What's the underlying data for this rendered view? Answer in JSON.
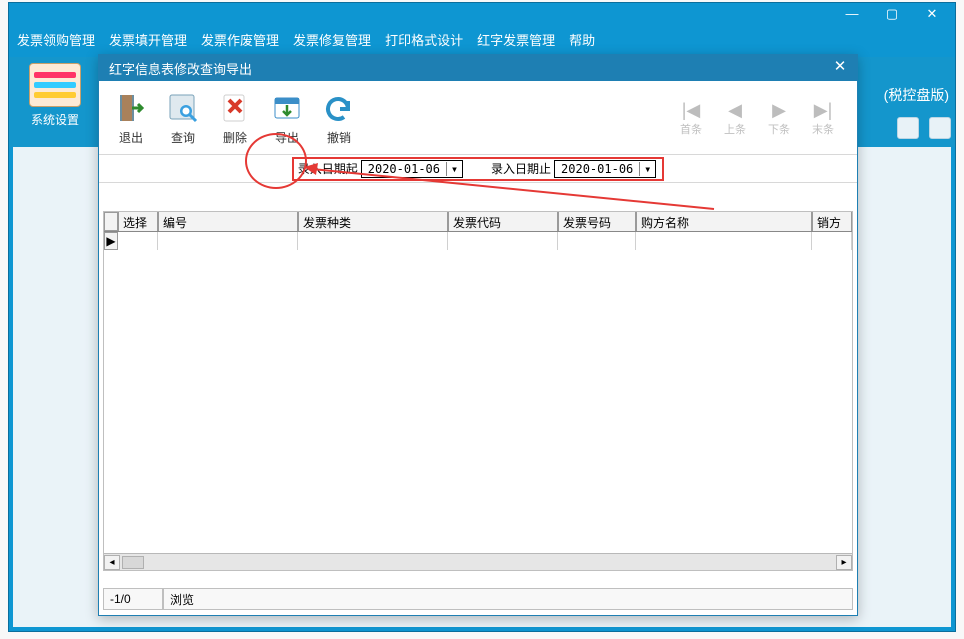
{
  "outer": {
    "menu": [
      "发票领购管理",
      "发票填开管理",
      "发票作废管理",
      "发票修复管理",
      "打印格式设计",
      "红字发票管理",
      "帮助"
    ],
    "sys_label": "系统设置",
    "right_tag": "(税控盘版)"
  },
  "dialog": {
    "title": "红字信息表修改查询导出",
    "toolbar": {
      "exit": "退出",
      "query": "查询",
      "delete": "删除",
      "export": "导出",
      "undo": "撤销"
    },
    "nav": {
      "first": "首条",
      "prev": "上条",
      "next": "下条",
      "last": "末条"
    },
    "filter": {
      "from_label": "录入日期起",
      "from_value": "2020-01-06",
      "to_label": "录入日期止",
      "to_value": "2020-01-06"
    },
    "columns": [
      "选择",
      "编号",
      "发票种类",
      "发票代码",
      "发票号码",
      "购方名称",
      "销方"
    ],
    "status": {
      "count": "-1/0",
      "mode": "浏览"
    }
  },
  "icons": {
    "exit": "door-arrow-icon",
    "query": "magnifier-icon",
    "delete": "x-red-icon",
    "export": "calendar-arrow-icon",
    "undo": "undo-arrow-icon",
    "first": "first-icon",
    "prev": "prev-icon",
    "next": "next-icon",
    "last": "last-icon",
    "close": "close-icon",
    "min": "minimize-icon",
    "max": "maximize-icon"
  },
  "colors": {
    "accent": "#1e7fb3",
    "bg": "#0e96d2",
    "annot": "#e53935"
  }
}
